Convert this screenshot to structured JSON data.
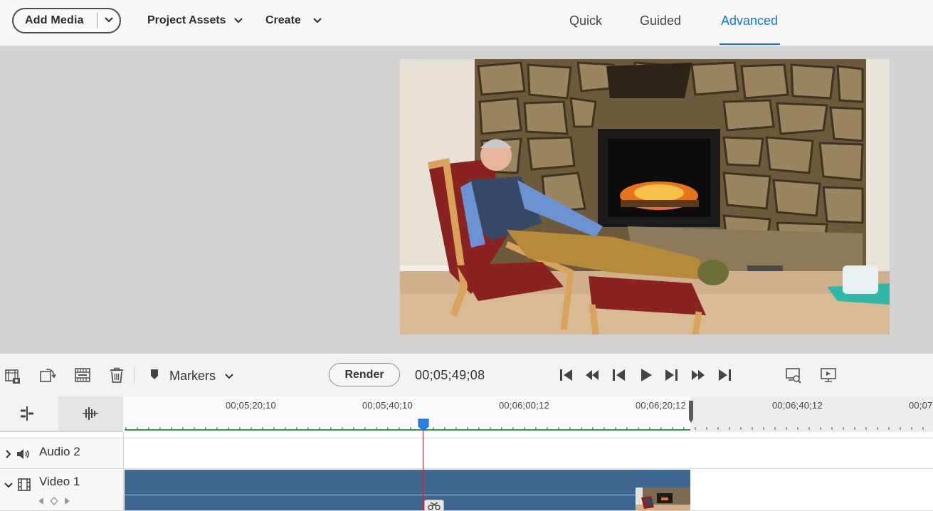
{
  "topbar": {
    "add_media": "Add Media",
    "project_assets": "Project Assets",
    "create": "Create",
    "modes": [
      "Quick",
      "Guided",
      "Advanced"
    ],
    "active_mode": "Advanced"
  },
  "toolbar": {
    "markers": "Markers",
    "render": "Render",
    "timecode": "00;05;49;08"
  },
  "timeline": {
    "ruler_labels": [
      "00;05;20;10",
      "00;05;40;10",
      "00;06;00;12",
      "00;06;20;12",
      "00;06;40;12",
      "00;07"
    ],
    "tracks": [
      {
        "name": "Audio 2",
        "icon": "speaker-icon"
      },
      {
        "name": "Video 1",
        "icon": "film-icon"
      }
    ]
  },
  "colors": {
    "accent": "#1473e6",
    "clip": "#3d6791",
    "playhead": "#c2262e",
    "ruler_green": "#2ea043"
  }
}
